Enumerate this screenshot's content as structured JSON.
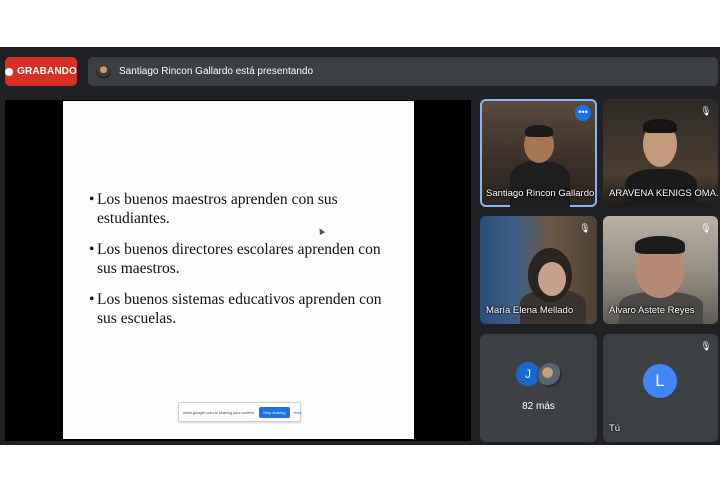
{
  "recording": {
    "label": "GRABANDO"
  },
  "presenter_bar": {
    "text": "Santiago Rincon Gallardo está presentando"
  },
  "slide": {
    "bullets": [
      {
        "marker": "•",
        "text": "Los buenos maestros aprenden con sus estudiantes."
      },
      {
        "marker": "•",
        "text": "Los buenos directores escolares aprenden con sus maestros."
      },
      {
        "marker": "•",
        "text": "Los buenos sistemas educativos aprenden con sus escuelas."
      }
    ],
    "share_notice": {
      "message": "meet.google.com is sharing your screen.",
      "stop_label": "Stop sharing",
      "hide_label": "Hide"
    }
  },
  "participants": [
    {
      "name": "Santiago Rincon Gallardo",
      "more_icon": "•••"
    },
    {
      "name": "ARAVENA KENIGS OMA...",
      "mute_icon": "mic-off-icon"
    },
    {
      "name": "María Elena Mellado",
      "mute_icon": "mic-off-icon"
    },
    {
      "name": "Álvaro Astete Reyes",
      "mute_icon": "mic-off-icon"
    }
  ],
  "others_tile": {
    "avatar_letter": "J",
    "count_label": "82 más"
  },
  "self_tile": {
    "avatar_letter": "L",
    "name": "Tú",
    "mute_icon": "mic-off-icon"
  },
  "colors": {
    "recording": "#d93025",
    "accent": "#1a73e8",
    "background": "#202124",
    "tile": "#3c4043"
  }
}
